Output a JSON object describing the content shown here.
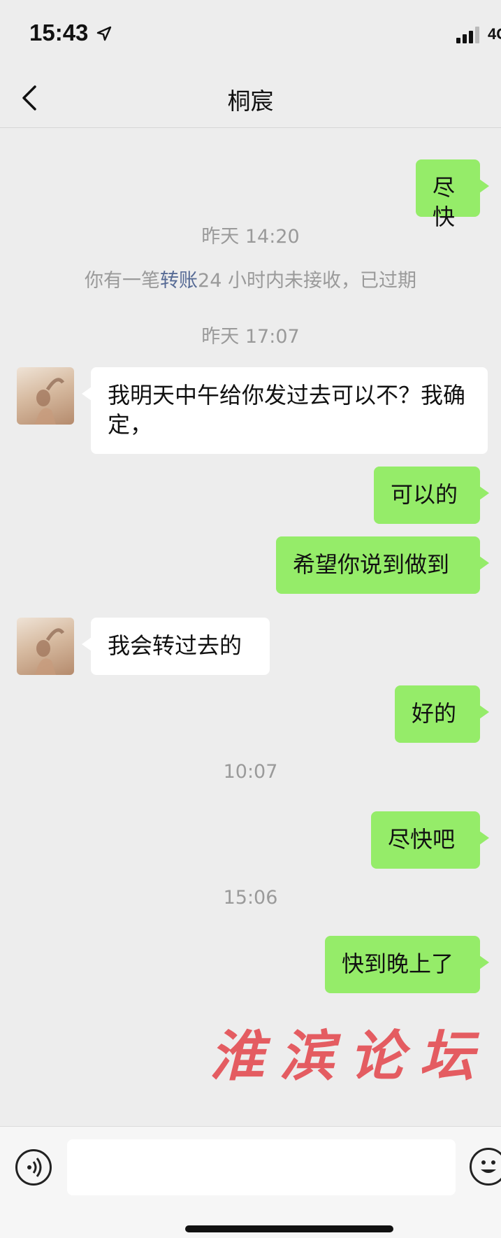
{
  "status_bar": {
    "time": "15:43",
    "network": "4G"
  },
  "header": {
    "title": "桐宸"
  },
  "messages": {
    "m1": "尽快",
    "ts1": "昨天 14:20",
    "sys1_prefix": "你有一笔",
    "sys1_link": "转账",
    "sys1_suffix": "24 小时内未接收，已过期",
    "ts2": "昨天 17:07",
    "m2": "我明天中午给你发过去可以不？我确定，",
    "m3": "可以的",
    "m4": "希望你说到做到",
    "m5": "我会转过去的",
    "m6": "好的",
    "ts3": "10:07",
    "m7": "尽快吧",
    "ts4": "15:06",
    "m8": "快到晚上了"
  },
  "watermark": "淮滨论坛",
  "colors": {
    "outgoing_bubble": "#95ec69",
    "incoming_bubble": "#ffffff",
    "link": "#576b95",
    "background": "#ededed"
  }
}
